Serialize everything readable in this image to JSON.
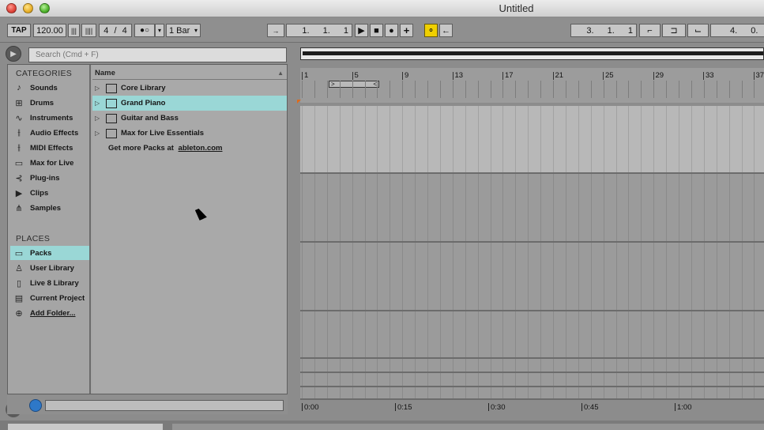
{
  "window": {
    "title": "Untitled"
  },
  "controls": {
    "tap_label": "TAP",
    "tempo": "120.00",
    "time_signature": "4 / 4",
    "metronome_symbol": "●○",
    "metro_arrow": "▾",
    "quantize": "1 Bar",
    "quantize_arrow": "▾",
    "arrangement_position": "1. 1. 1",
    "loop_start": "3. 1. 1",
    "loop_length": "4. 0.",
    "follow_symbol": "→",
    "play_symbol": "▶",
    "stop_symbol": "■",
    "record_symbol": "●",
    "add_symbol": "+",
    "automation_symbol": "⚬",
    "back_symbol": "←",
    "punch_in_symbol": "⌐",
    "loop_symbol": "⊐",
    "punch_out_symbol": "⌙",
    "nudge_down_symbol": "|||",
    "nudge_up_symbol": "||||",
    "accent_color": "#9ad7d6",
    "arm_color": "#f0d000"
  },
  "browser": {
    "search_placeholder": "Search (Cmd + F)",
    "categories_title": "CATEGORIES",
    "categories": [
      {
        "label": "Sounds",
        "icon": "note-icon",
        "glyph": "♪"
      },
      {
        "label": "Drums",
        "icon": "grid-icon",
        "glyph": "⊞"
      },
      {
        "label": "Instruments",
        "icon": "wave-icon",
        "glyph": "∿"
      },
      {
        "label": "Audio Effects",
        "icon": "fader-icon",
        "glyph": "⫲"
      },
      {
        "label": "MIDI Effects",
        "icon": "midi-fader-icon",
        "glyph": "⫲"
      },
      {
        "label": "Max for Live",
        "icon": "max-icon",
        "glyph": "▭"
      },
      {
        "label": "Plug-ins",
        "icon": "plug-icon",
        "glyph": "⊰"
      },
      {
        "label": "Clips",
        "icon": "clip-icon",
        "glyph": "▶"
      },
      {
        "label": "Samples",
        "icon": "sample-wave-icon",
        "glyph": "⋔"
      }
    ],
    "places_title": "PLACES",
    "places": [
      {
        "label": "Packs",
        "icon": "packs-icon",
        "glyph": "▭",
        "selected": true
      },
      {
        "label": "User Library",
        "icon": "user-icon",
        "glyph": "♙"
      },
      {
        "label": "Live 8 Library",
        "icon": "library-icon",
        "glyph": "▯"
      },
      {
        "label": "Current Project",
        "icon": "project-icon",
        "glyph": "▤"
      },
      {
        "label": "Add Folder...",
        "icon": "add-folder-icon",
        "glyph": "⊕"
      }
    ],
    "list_header": "Name",
    "sort_symbol": "▲",
    "items": [
      {
        "label": "Core Library",
        "expander": "▷"
      },
      {
        "label": "Grand Piano",
        "expander": "▷",
        "selected": true
      },
      {
        "label": "Guitar and Bass",
        "expander": "▷"
      },
      {
        "label": "Max for Live Essentials",
        "expander": "▷"
      }
    ],
    "get_more_text": "Get more Packs at",
    "get_more_link": "ableton.com"
  },
  "arrangement": {
    "bar_labels": [
      "1",
      "5",
      "9",
      "13",
      "17",
      "21",
      "25",
      "29",
      "33",
      "37"
    ],
    "time_labels": [
      "0:00",
      "0:15",
      "0:30",
      "0:45",
      "1:00"
    ],
    "loop_brace_left": ">",
    "loop_brace_right": "<"
  }
}
